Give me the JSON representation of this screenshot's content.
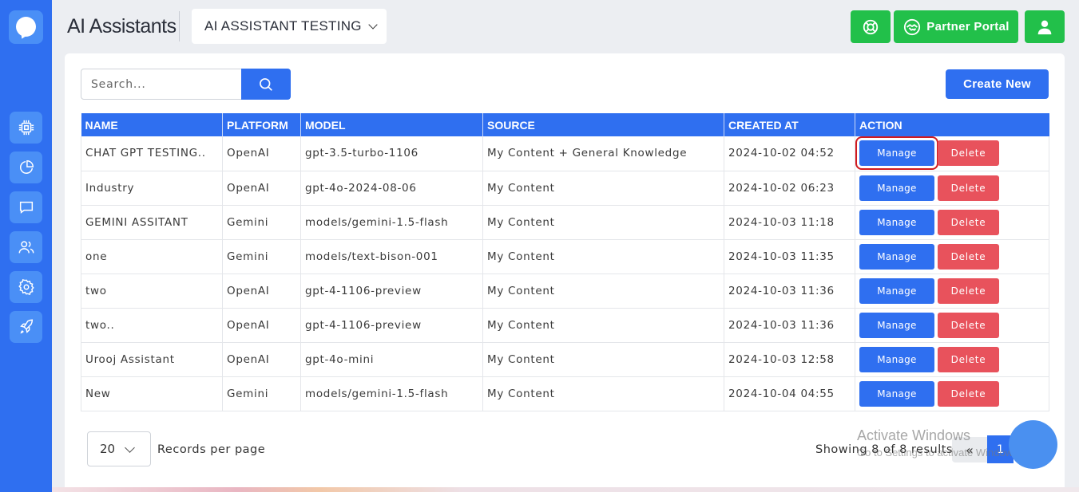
{
  "app": {
    "page_title": "AI Assistants",
    "workspace": "AI ASSISTANT TESTING"
  },
  "header_actions": {
    "support_icon": "lifebuoy-icon",
    "partner_label": "Partner Portal",
    "partner_icon": "handshake-icon",
    "profile_icon": "user-icon"
  },
  "sidebar": {
    "items": [
      {
        "name": "chip",
        "icon": "cpu-icon"
      },
      {
        "name": "analytics",
        "icon": "pie-chart-icon"
      },
      {
        "name": "chat",
        "icon": "chat-icon"
      },
      {
        "name": "users",
        "icon": "users-icon"
      },
      {
        "name": "settings",
        "icon": "gear-icon"
      },
      {
        "name": "launch",
        "icon": "rocket-icon"
      }
    ]
  },
  "search": {
    "placeholder": "Search..."
  },
  "toolbar": {
    "create_label": "Create New"
  },
  "table": {
    "headers": [
      "NAME",
      "PLATFORM",
      "MODEL",
      "SOURCE",
      "CREATED AT",
      "ACTION"
    ],
    "manage_label": "Manage",
    "delete_label": "Delete",
    "rows": [
      {
        "name": "CHAT GPT TESTING..",
        "platform": "OpenAI",
        "model": "gpt-3.5-turbo-1106",
        "source": "My Content + General Knowledge",
        "created_at": "2024-10-02 04:52"
      },
      {
        "name": "Industry",
        "platform": "OpenAI",
        "model": "gpt-4o-2024-08-06",
        "source": "My Content",
        "created_at": "2024-10-02 06:23"
      },
      {
        "name": "GEMINI ASSITANT",
        "platform": "Gemini",
        "model": "models/gemini-1.5-flash",
        "source": "My Content",
        "created_at": "2024-10-03 11:18"
      },
      {
        "name": "one",
        "platform": "Gemini",
        "model": "models/text-bison-001",
        "source": "My Content",
        "created_at": "2024-10-03 11:35"
      },
      {
        "name": "two",
        "platform": "OpenAI",
        "model": "gpt-4-1106-preview",
        "source": "My Content",
        "created_at": "2024-10-03 11:36"
      },
      {
        "name": "two..",
        "platform": "OpenAI",
        "model": "gpt-4-1106-preview",
        "source": "My Content",
        "created_at": "2024-10-03 11:36"
      },
      {
        "name": "Urooj Assistant",
        "platform": "OpenAI",
        "model": "gpt-4o-mini",
        "source": "My Content",
        "created_at": "2024-10-03 12:58"
      },
      {
        "name": "New",
        "platform": "Gemini",
        "model": "models/gemini-1.5-flash",
        "source": "My Content",
        "created_at": "2024-10-04 04:55"
      }
    ]
  },
  "footer": {
    "per_page_value": "20",
    "per_page_label": "Records per page",
    "showing_text": "Showing 8 of 8 results",
    "prev_label": "«",
    "current_page": "1"
  },
  "watermark": {
    "line1": "Activate Windows",
    "line2": "Go to Settings to activate Windows."
  },
  "colors": {
    "primary": "#2f6ff0",
    "success": "#22c04a",
    "danger": "#e8525c",
    "highlight": "#d0191f"
  }
}
